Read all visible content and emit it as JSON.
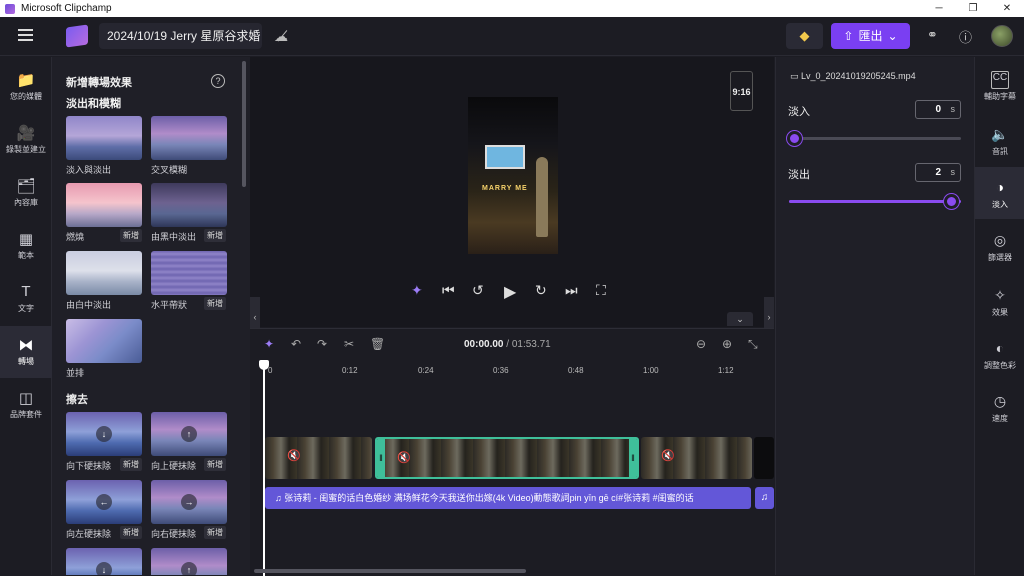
{
  "titlebar": {
    "title": "Microsoft Clipchamp",
    "minimize": "─",
    "maximize": "❐",
    "close": "✕"
  },
  "header": {
    "project_title": "2024/10/19 Jerry 星原谷求婚",
    "export_label": "匯出",
    "export_icon": "upload-icon",
    "chevron": "⌄"
  },
  "left_rail": [
    {
      "label": "您的媒體",
      "icon": "📁",
      "name": "folder-icon"
    },
    {
      "label": "錄製並建立",
      "icon": "🎥",
      "name": "camera-icon"
    },
    {
      "label": "內容庫",
      "icon": "🗂",
      "name": "library-icon"
    },
    {
      "label": "範本",
      "icon": "▦",
      "name": "templates-icon"
    },
    {
      "label": "文字",
      "icon": "T",
      "name": "text-icon"
    },
    {
      "label": "轉場",
      "icon": "⧓",
      "name": "transitions-icon"
    },
    {
      "label": "品牌套件",
      "icon": "◫",
      "name": "brand-kit-icon"
    }
  ],
  "panel": {
    "title": "新增轉場效果",
    "section1": "淡出和模糊",
    "section2": "擦去",
    "tiles": [
      {
        "label": "淡入與淡出",
        "badge": ""
      },
      {
        "label": "交叉模糊",
        "badge": ""
      },
      {
        "label": "燃燒",
        "badge": "新增"
      },
      {
        "label": "由黑中淡出",
        "badge": "新增"
      },
      {
        "label": "由白中淡出",
        "badge": ""
      },
      {
        "label": "水平帶狀",
        "badge": "新增"
      },
      {
        "label": "並排",
        "badge": ""
      },
      {
        "label": "向下硬抹除",
        "badge": "新增"
      },
      {
        "label": "向上硬抹除",
        "badge": "新增"
      },
      {
        "label": "向左硬抹除",
        "badge": "新增"
      },
      {
        "label": "向右硬抹除",
        "badge": "新增"
      }
    ]
  },
  "preview": {
    "aspect_ratio": "9:16",
    "sign_text": "MARRY ME"
  },
  "timeline": {
    "current_time": "00:00.00",
    "total_time": "/ 01:53.71",
    "ticks": [
      "0",
      "0:12",
      "0:24",
      "0:36",
      "0:48",
      "1:00",
      "1:12"
    ],
    "audio_title": "张诗莉 - 闺蜜的话白色婚纱 满场鲜花今天我送你出嫁(4k Video)動態歌詞pin yīn gē cí#张诗莉 #闺蜜的话"
  },
  "properties": {
    "file_name": "Lv_0_20241019205245.mp4",
    "fade_in_label": "淡入",
    "fade_in_value": "0",
    "fade_in_unit": "s",
    "fade_in_fraction": 0,
    "fade_out_label": "淡出",
    "fade_out_value": "2",
    "fade_out_unit": "s",
    "fade_out_fraction": 1
  },
  "right_rail": [
    {
      "label": "輔助字幕",
      "icon": "CC",
      "name": "captions-icon"
    },
    {
      "label": "音訊",
      "icon": "🔈",
      "name": "audio-icon"
    },
    {
      "label": "淡入",
      "icon": "◑",
      "name": "fade-icon"
    },
    {
      "label": "篩選器",
      "icon": "◎",
      "name": "filters-icon"
    },
    {
      "label": "效果",
      "icon": "✧",
      "name": "effects-icon"
    },
    {
      "label": "調整色彩",
      "icon": "◐",
      "name": "color-icon"
    },
    {
      "label": "速度",
      "icon": "◷",
      "name": "speed-icon"
    }
  ],
  "colors": {
    "accent": "#7a3ff2",
    "selected_clip": "#3fbf9a",
    "audio": "#6357d8"
  }
}
